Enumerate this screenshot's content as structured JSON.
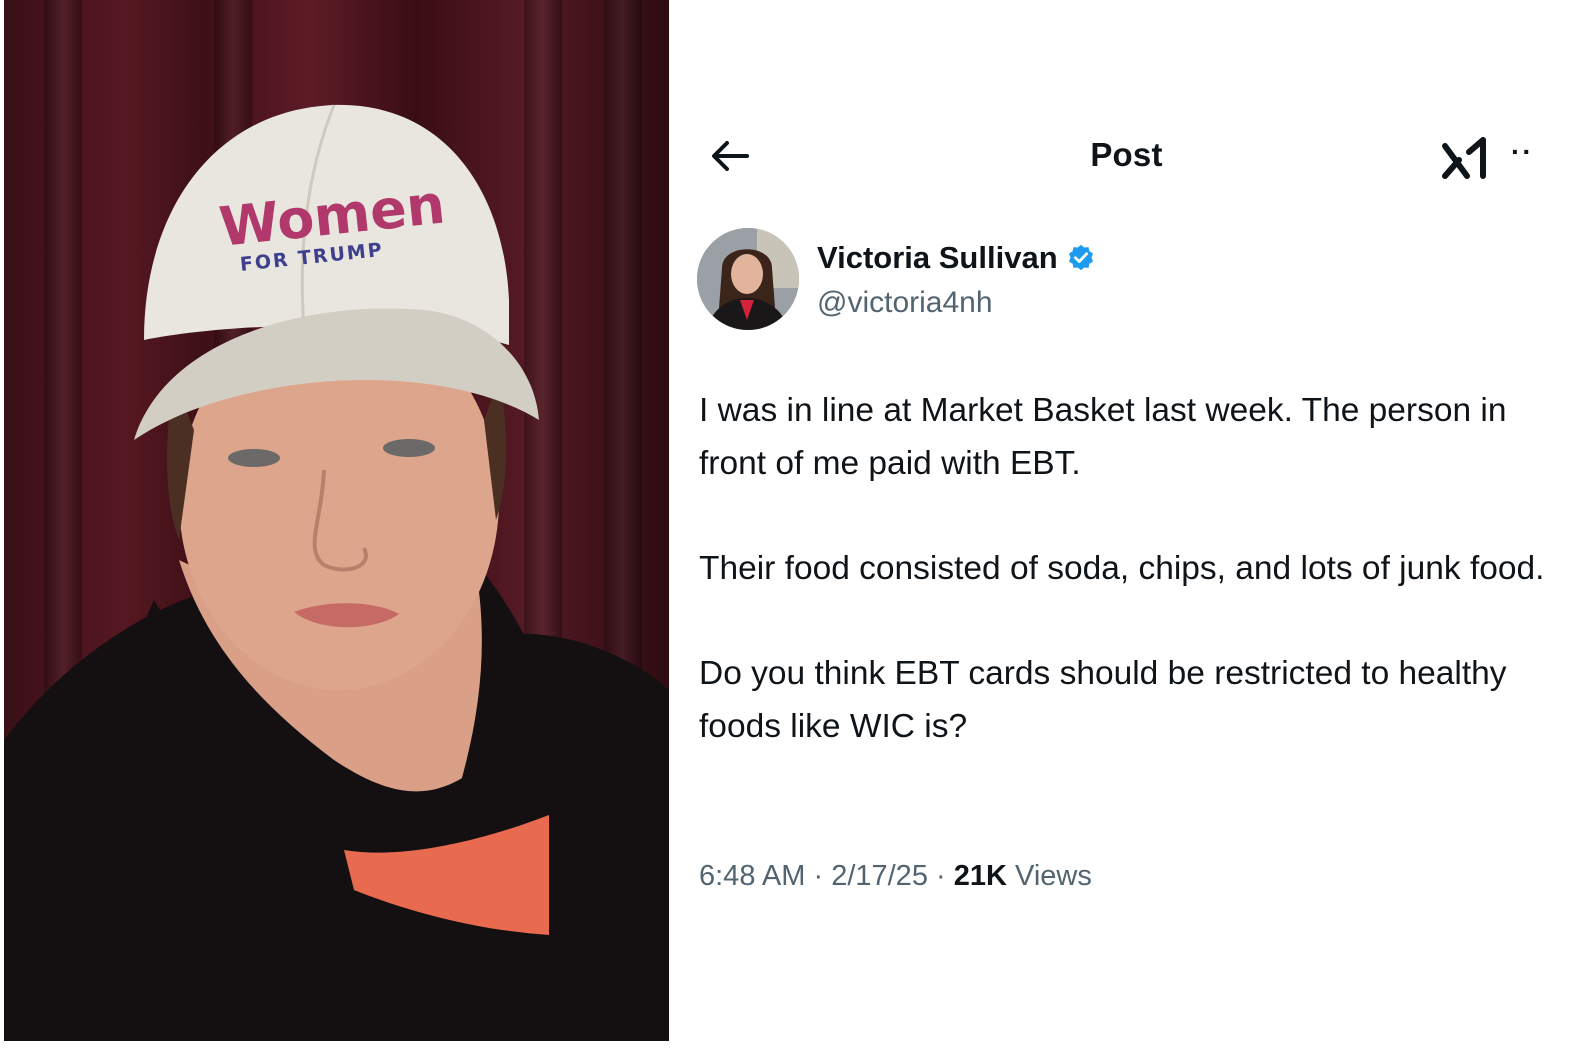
{
  "photo": {
    "hat_line1": "Women",
    "hat_line2": "FOR TRUMP",
    "colors": {
      "curtain": "#4a1520",
      "hat": "#e9e6df",
      "hat_text_pink": "#b0386a",
      "hat_text_blue": "#3e3f8f",
      "shirt": "#141012",
      "undershirt": "#e86a4f"
    }
  },
  "topbar": {
    "back_icon": "arrow-left-icon",
    "title": "Post",
    "grok_icon": "grok-icon",
    "more_label": "··"
  },
  "author": {
    "name": "Victoria Sullivan",
    "verified_icon": "verified-badge-icon",
    "verified_color": "#1d9bf0",
    "handle": "@victoria4nh"
  },
  "tweet": {
    "paragraphs": [
      "I was in line at Market Basket last week. The person in front of me paid with EBT.",
      "Their food consisted of soda, chips, and lots of junk food.",
      "Do you think EBT cards should be restricted to healthy foods like WIC is?"
    ]
  },
  "meta": {
    "time": "6:48 AM",
    "separator": " · ",
    "date": "2/17/25",
    "views_count": "21K",
    "views_label": " Views"
  }
}
